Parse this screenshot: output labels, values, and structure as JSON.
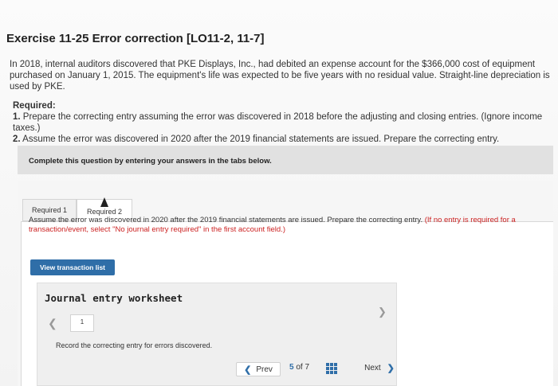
{
  "exercise": {
    "title": "Exercise 11-25 Error correction [LO11-2, 11-7]",
    "problem_text": "In 2018, internal auditors discovered that PKE Displays, Inc., had debited an expense account for the $366,000 cost of equipment purchased on January 1, 2015. The equipment's life was expected to be five years with no residual value. Straight-line depreciation is used by PKE."
  },
  "required": {
    "heading": "Required:",
    "item1_num": "1.",
    "item1_text": " Prepare the correcting entry assuming the error was discovered in 2018 before the adjusting and closing entries. (Ignore income taxes.)",
    "item2_num": "2.",
    "item2_text": " Assume the error was discovered in 2020 after the 2019 financial statements are issued. Prepare the correcting entry."
  },
  "instruction": "Complete this question by entering your answers in the tabs below.",
  "tabs": [
    {
      "label": "Required 1"
    },
    {
      "label": "Required 2"
    }
  ],
  "prompt": {
    "text": "Assume the error was discovered in 2020 after the 2019 financial statements are issued. Prepare the correcting entry. ",
    "hint": "(If no entry is required for a transaction/event, select \"No journal entry required\" in the first account field.)"
  },
  "buttons": {
    "view_transactions": "View transaction list"
  },
  "worksheet": {
    "title": "Journal entry worksheet",
    "page": "1",
    "record_text": "Record the correcting entry for errors discovered."
  },
  "navigation": {
    "prev_label": "Prev",
    "current": "5",
    "of_label": "of",
    "total": "7",
    "next_label": "Next"
  },
  "icons": {
    "prev": "chevron-left-icon",
    "next": "chevron-right-icon",
    "grid": "grid-icon",
    "worksheet_left": "chevron-left-icon",
    "worksheet_right": "chevron-right-icon"
  },
  "colors": {
    "accent": "#2f6ea8",
    "hint": "#cc2222"
  }
}
